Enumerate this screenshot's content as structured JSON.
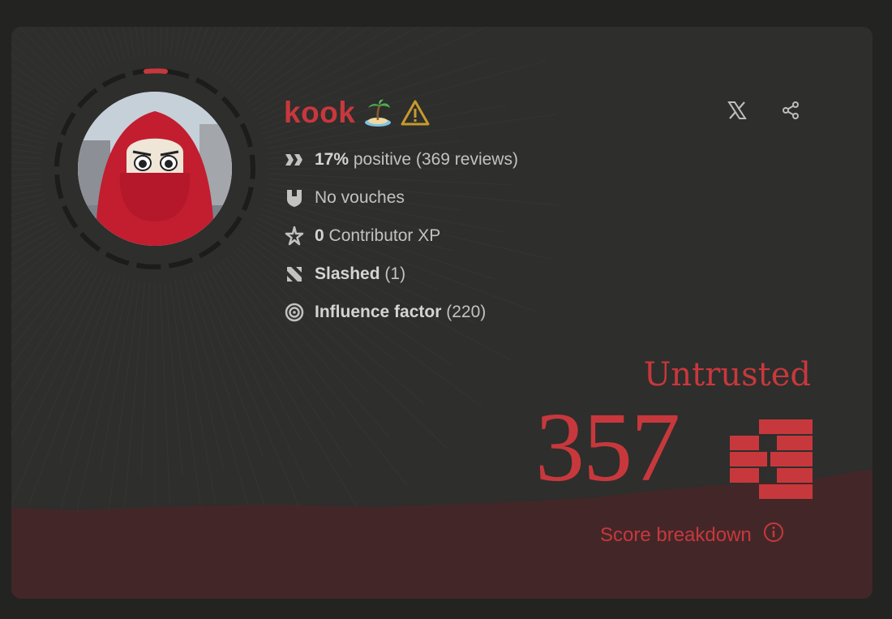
{
  "profile": {
    "name": "kook",
    "name_emoji": "🏝",
    "warning_icon": "warning-triangle-icon"
  },
  "stats": {
    "positive_percent": "17%",
    "positive_label": "positive",
    "reviews": "(369 reviews)",
    "vouches": "No vouches",
    "xp_value": "0",
    "xp_label": "Contributor XP",
    "slashed_label": "Slashed",
    "slashed_count": "(1)",
    "influence_label": "Influence factor",
    "influence_value": "(220)"
  },
  "actions": {
    "x_icon": "x-logo-icon",
    "share_icon": "share-icon"
  },
  "score": {
    "level": "Untrusted",
    "value": "357",
    "breakdown_label": "Score breakdown",
    "breakdown_icon": "info-icon"
  },
  "colors": {
    "accent": "#c7383d",
    "card_bg": "#2e2e2c",
    "page_bg": "#232322",
    "terrain": "#432728",
    "text": "#c2c2c2"
  }
}
